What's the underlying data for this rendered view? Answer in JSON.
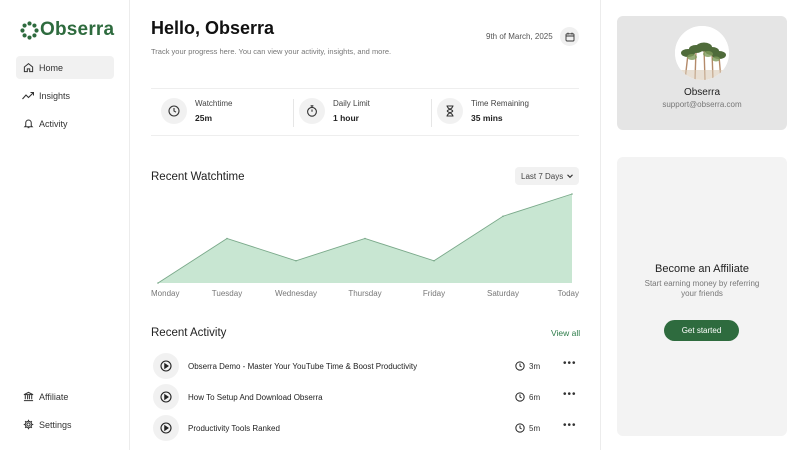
{
  "brand": {
    "name": "Obserra",
    "color": "#2e6b3e"
  },
  "sidebar": {
    "items": [
      {
        "label": "Home",
        "icon": "home-icon",
        "active": true
      },
      {
        "label": "Insights",
        "icon": "trend-icon",
        "active": false
      },
      {
        "label": "Activity",
        "icon": "bell-icon",
        "active": false
      }
    ],
    "bottom_items": [
      {
        "label": "Affiliate",
        "icon": "bank-icon"
      },
      {
        "label": "Settings",
        "icon": "gear-icon"
      }
    ]
  },
  "header": {
    "greeting": "Hello, Obserra",
    "subtitle": "Track your progress here. You can view your activity, insights, and more.",
    "date": "9th of March, 2025"
  },
  "stats": [
    {
      "label": "Watchtime",
      "value": "25m",
      "icon": "clock-icon"
    },
    {
      "label": "Daily Limit",
      "value": "1 hour",
      "icon": "stopwatch-icon"
    },
    {
      "label": "Time Remaining",
      "value": "35 mins",
      "icon": "hourglass-icon"
    }
  ],
  "watchtime": {
    "title": "Recent Watchtime",
    "range": "Last 7 Days"
  },
  "chart_data": {
    "type": "area",
    "categories": [
      "Monday",
      "Tuesday",
      "Wednesday",
      "Thursday",
      "Friday",
      "Saturday",
      "Today"
    ],
    "values": [
      0,
      50,
      25,
      50,
      25,
      75,
      100
    ],
    "title": "Recent Watchtime",
    "xlabel": "",
    "ylabel": "",
    "ylim": [
      0,
      100
    ],
    "grid": false,
    "fill_color": "#c8e6d2",
    "line_color": "#7aa98a"
  },
  "activity": {
    "title": "Recent Activity",
    "view_all": "View all",
    "items": [
      {
        "title": "Obserra Demo - Master Your YouTube Time & Boost Productivity",
        "duration": "3m"
      },
      {
        "title": "How To Setup And Download Obserra",
        "duration": "6m"
      },
      {
        "title": "Productivity Tools Ranked",
        "duration": "5m"
      }
    ]
  },
  "profile": {
    "name": "Obserra",
    "email": "support@obserra.com"
  },
  "affiliate": {
    "title": "Become an Affiliate",
    "subtitle": "Start earning money by referring your friends",
    "button": "Get started"
  }
}
